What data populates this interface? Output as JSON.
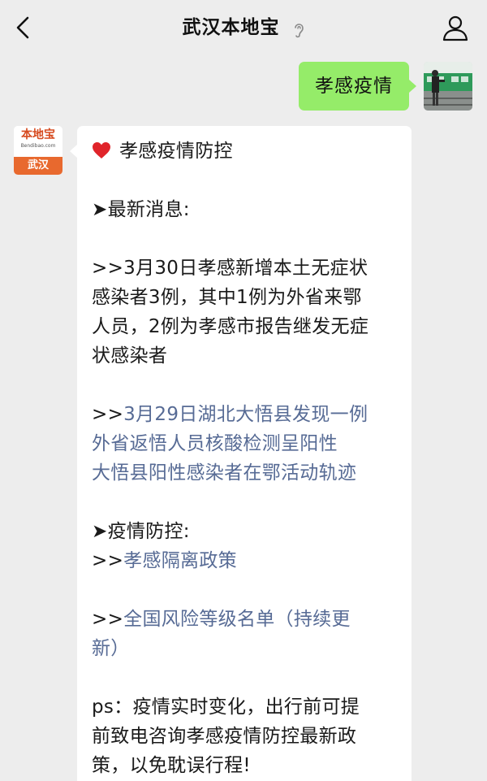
{
  "header": {
    "title": "武汉本地宝"
  },
  "outgoing": {
    "text": "孝感疫情"
  },
  "bot": {
    "avatar_logo": "本地宝",
    "avatar_sub": "Bendibao.com",
    "avatar_city": "武汉"
  },
  "message": {
    "heading": "孝感疫情防控",
    "section1": "➤最新消息:",
    "item1_line1": ">>3月30日孝感新增本土无症状",
    "item1_line2": "感染者3例，其中1例为外省来鄂",
    "item1_line3": "人员，2例为孝感市报告继发无症",
    "item1_line4": "状感染者",
    "item2_prefix": ">>",
    "item2_line1": "3月29日湖北大悟县发现一例",
    "item2_line2": "外省返悟人员核酸检测呈阳性",
    "item2_line3": "大悟县阳性感染者在鄂活动轨迹",
    "section2": "➤疫情防控:",
    "item3_prefix": ">>",
    "item3_link": "孝感隔离政策",
    "item4_prefix": ">>",
    "item4_line1": "全国风险等级名单（持续更",
    "item4_line2": "新）",
    "ps_line1": "ps：疫情实时变化，出行前可提",
    "ps_line2": "前致电咨询孝感疫情防控最新政",
    "ps_line3": "策，以免耽误行程!"
  },
  "colors": {
    "background": "#ededed",
    "outgoing_bubble": "#95ec69",
    "incoming_bubble": "#ffffff",
    "link": "#576b95",
    "logo_orange": "#e8692e"
  },
  "icons": {
    "back": "chevron-left-icon",
    "title_badge": "ear-icon",
    "profile": "person-icon",
    "heading": "heart-icon"
  }
}
